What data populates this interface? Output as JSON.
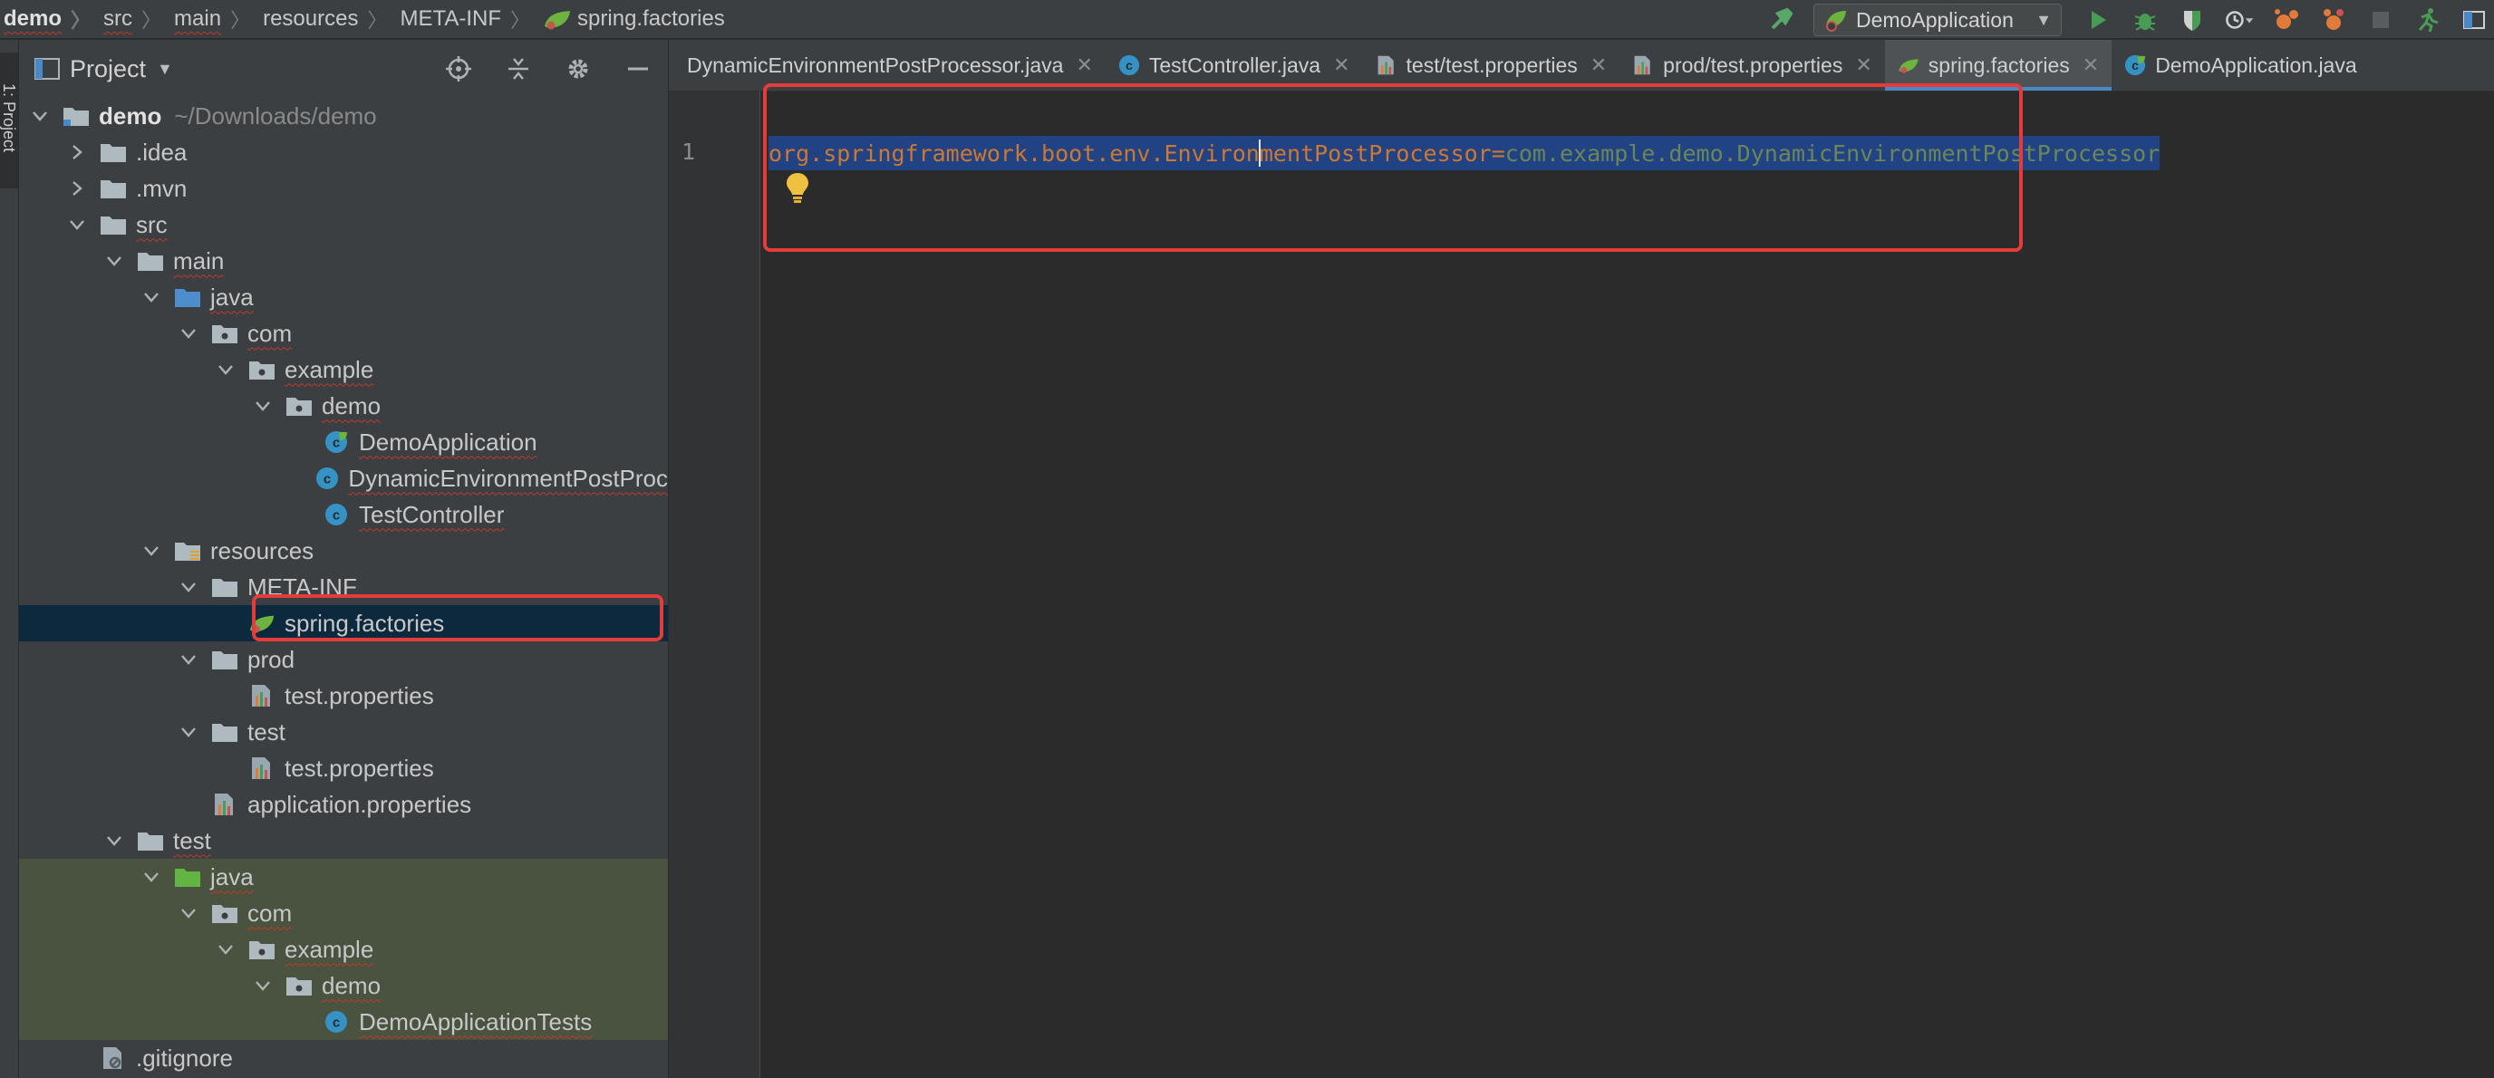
{
  "breadcrumbs": [
    {
      "label": "demo",
      "squiggle": true
    },
    {
      "label": "src",
      "squiggle": true
    },
    {
      "label": "main",
      "squiggle": true
    },
    {
      "label": "resources",
      "squiggle": false
    },
    {
      "label": "META-INF",
      "squiggle": false
    },
    {
      "label": "spring.factories",
      "squiggle": false
    }
  ],
  "toolbar": {
    "run_config": "DemoApplication",
    "icons": [
      "build-icon",
      "run-icon",
      "debug-icon",
      "coverage-icon",
      "profile-icon",
      "attach-icon",
      "stop-icon",
      "update-icon",
      "project-structure-icon"
    ]
  },
  "left_stripe": {
    "tab_label": "1: Project"
  },
  "project_panel": {
    "title": "Project",
    "tree": [
      {
        "label": "demo",
        "hint": "~/Downloads/demo",
        "depth": 0,
        "expanded": true,
        "icon": "module-folder",
        "bold": true
      },
      {
        "label": ".idea",
        "depth": 1,
        "expanded": false,
        "icon": "folder"
      },
      {
        "label": ".mvn",
        "depth": 1,
        "expanded": false,
        "icon": "folder"
      },
      {
        "label": "src",
        "depth": 1,
        "expanded": true,
        "icon": "folder",
        "squiggle": true
      },
      {
        "label": "main",
        "depth": 2,
        "expanded": true,
        "icon": "folder",
        "squiggle": true
      },
      {
        "label": "java",
        "depth": 3,
        "expanded": true,
        "icon": "source-folder",
        "squiggle": true
      },
      {
        "label": "com",
        "depth": 4,
        "expanded": true,
        "icon": "package",
        "squiggle": true
      },
      {
        "label": "example",
        "depth": 5,
        "expanded": true,
        "icon": "package",
        "squiggle": true
      },
      {
        "label": "demo",
        "depth": 6,
        "expanded": true,
        "icon": "package",
        "squiggle": true
      },
      {
        "label": "DemoApplication",
        "depth": 7,
        "icon": "spring-class",
        "squiggle": true
      },
      {
        "label": "DynamicEnvironmentPostProc",
        "depth": 7,
        "icon": "class",
        "squiggle": true
      },
      {
        "label": "TestController",
        "depth": 7,
        "icon": "class",
        "squiggle": true
      },
      {
        "label": "resources",
        "depth": 3,
        "expanded": true,
        "icon": "resources-folder"
      },
      {
        "label": "META-INF",
        "depth": 4,
        "expanded": true,
        "icon": "folder"
      },
      {
        "label": "spring.factories",
        "depth": 5,
        "icon": "spring-file",
        "selected": true
      },
      {
        "label": "prod",
        "depth": 4,
        "expanded": true,
        "icon": "folder"
      },
      {
        "label": "test.properties",
        "depth": 5,
        "icon": "properties-file"
      },
      {
        "label": "test",
        "depth": 4,
        "expanded": true,
        "icon": "folder"
      },
      {
        "label": "test.properties",
        "depth": 5,
        "icon": "properties-file"
      },
      {
        "label": "application.properties",
        "depth": 4,
        "icon": "properties-file"
      },
      {
        "label": "test",
        "depth": 2,
        "expanded": true,
        "icon": "folder",
        "squiggle": true
      },
      {
        "label": "java",
        "depth": 3,
        "expanded": true,
        "icon": "test-folder",
        "squiggle": true,
        "green": true
      },
      {
        "label": "com",
        "depth": 4,
        "expanded": true,
        "icon": "package",
        "squiggle": true,
        "green": true
      },
      {
        "label": "example",
        "depth": 5,
        "expanded": true,
        "icon": "package",
        "squiggle": true,
        "green": true
      },
      {
        "label": "demo",
        "depth": 6,
        "expanded": true,
        "icon": "package",
        "squiggle": true,
        "green": true
      },
      {
        "label": "DemoApplicationTests",
        "depth": 7,
        "icon": "class",
        "squiggle": true,
        "green": true
      },
      {
        "label": ".gitignore",
        "depth": 1,
        "icon": "ignore-file"
      }
    ]
  },
  "editor": {
    "tabs": [
      {
        "label": "DynamicEnvironmentPostProcessor.java",
        "icon": "none",
        "active": false,
        "closable": true
      },
      {
        "label": "TestController.java",
        "icon": "class",
        "active": false,
        "closable": true
      },
      {
        "label": "test/test.properties",
        "icon": "properties-file",
        "active": false,
        "closable": true
      },
      {
        "label": "prod/test.properties",
        "icon": "properties-file",
        "active": false,
        "closable": true
      },
      {
        "label": "spring.factories",
        "icon": "spring-file",
        "active": true,
        "closable": true
      },
      {
        "label": "DemoApplication.java",
        "icon": "spring-class",
        "active": false,
        "closable": false
      }
    ],
    "line_number": "1",
    "code": {
      "key_before_cursor": "org.springframework.boot.env.Environ",
      "key_after_cursor": "mentPostProcessor",
      "separator": "=",
      "value": "com.example.demo.DynamicEnvironmentPostProcessor"
    }
  },
  "colors": {
    "highlight_red": "#e43b3b",
    "selection_blue": "#214283",
    "key_orange": "#cc7832",
    "value_green": "#6a8759",
    "test_green_bg": "#49533f"
  }
}
